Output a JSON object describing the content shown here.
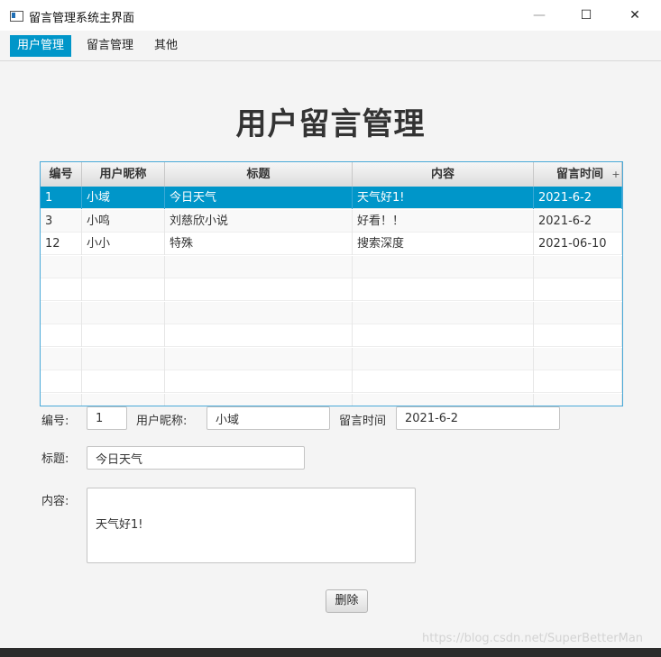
{
  "window": {
    "title": "留言管理系统主界面",
    "minimize": "—",
    "maximize": "☐",
    "close": "✕"
  },
  "menu": {
    "items": [
      {
        "label": "用户管理"
      },
      {
        "label": "留言管理"
      },
      {
        "label": "其他"
      }
    ]
  },
  "heading": "用户留言管理",
  "table": {
    "columns": [
      "编号",
      "用户昵称",
      "标题",
      "内容",
      "留言时间"
    ],
    "menu_button": "+",
    "rows": [
      [
        "1",
        "小域",
        "今日天气",
        "天气好1!",
        "2021-6-2"
      ],
      [
        "3",
        "小鸣",
        "刘慈欣小说",
        "好看！！",
        "2021-6-2"
      ],
      [
        "12",
        "小小",
        "特殊",
        "搜索深度",
        "2021-06-10"
      ]
    ],
    "selected_row": 0
  },
  "form": {
    "id_label": "编号:",
    "id_value": "1",
    "nick_label": "用户昵称:",
    "nick_value": "小域",
    "time_label": "留言时间",
    "time_value": "2021-6-2",
    "title_label": "标题:",
    "title_value": "今日天气",
    "content_label": "内容:",
    "content_value": "天气好1!"
  },
  "delete_button": "删除",
  "watermark": "https://blog.csdn.net/SuperBetterMan",
  "colors": {
    "accent": "#0096c9",
    "table_border": "#49a9d8"
  }
}
